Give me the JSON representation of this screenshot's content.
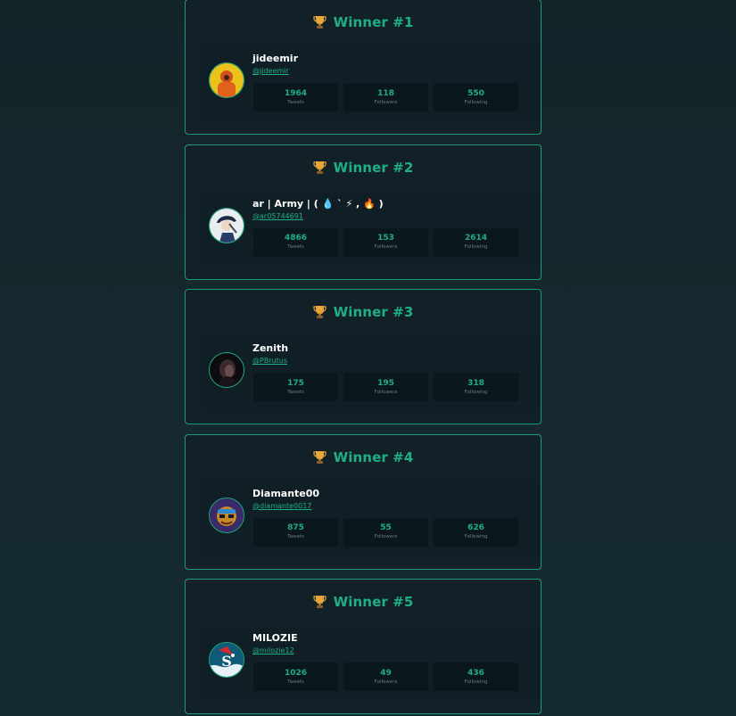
{
  "winners": [
    {
      "title": "Winner #1",
      "name": "jideemir",
      "handle": "@jideemir",
      "avatar": "orange-hoodie-avatar",
      "stats": [
        {
          "value": "1964",
          "label": "Tweets"
        },
        {
          "value": "118",
          "label": "Followers"
        },
        {
          "value": "550",
          "label": "Following"
        }
      ]
    },
    {
      "title": "Winner #2",
      "name": "ar | Army | ( 💧 ` ⚡ , 🔥 )",
      "handle": "@ar05744691",
      "avatar": "anime-character-avatar",
      "stats": [
        {
          "value": "4866",
          "label": "Tweets"
        },
        {
          "value": "153",
          "label": "Followers"
        },
        {
          "value": "2614",
          "label": "Following"
        }
      ]
    },
    {
      "title": "Winner #3",
      "name": "Zenith",
      "handle": "@PBrutus",
      "avatar": "dark-portrait-avatar",
      "stats": [
        {
          "value": "175",
          "label": "Tweets"
        },
        {
          "value": "195",
          "label": "Followers"
        },
        {
          "value": "318",
          "label": "Following"
        }
      ]
    },
    {
      "title": "Winner #4",
      "name": "Diamante00",
      "handle": "@diamante0017",
      "avatar": "cartoon-avatar",
      "stats": [
        {
          "value": "875",
          "label": "Tweets"
        },
        {
          "value": "55",
          "label": "Followers"
        },
        {
          "value": "626",
          "label": "Following"
        }
      ]
    },
    {
      "title": "Winner #5",
      "name": "MILOZIE",
      "handle": "@milozie12",
      "avatar": "santa-s-logo-avatar",
      "stats": [
        {
          "value": "1026",
          "label": "Tweets"
        },
        {
          "value": "49",
          "label": "Followers"
        },
        {
          "value": "436",
          "label": "Following"
        }
      ]
    }
  ],
  "colors": {
    "accent": "#1fae85",
    "background": "#13272c",
    "card": "#122127",
    "stat_box": "#0a171c"
  }
}
